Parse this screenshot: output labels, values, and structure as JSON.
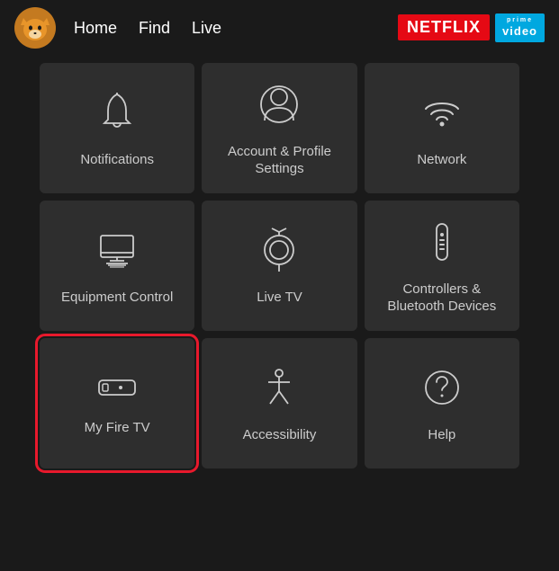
{
  "nav": {
    "links": [
      {
        "label": "Home",
        "active": false
      },
      {
        "label": "Find",
        "active": false
      },
      {
        "label": "Live",
        "active": false
      }
    ],
    "netflix_label": "NETFLIX",
    "prime_top": "prime",
    "prime_bottom": "video"
  },
  "grid": {
    "items": [
      {
        "id": "notifications",
        "label": "Notifications",
        "icon": "bell"
      },
      {
        "id": "account-profile",
        "label": "Account & Profile Settings",
        "icon": "person"
      },
      {
        "id": "network",
        "label": "Network",
        "icon": "wifi"
      },
      {
        "id": "equipment-control",
        "label": "Equipment Control",
        "icon": "monitor"
      },
      {
        "id": "live-tv",
        "label": "Live TV",
        "icon": "antenna"
      },
      {
        "id": "controllers-bluetooth",
        "label": "Controllers & Bluetooth Devices",
        "icon": "remote"
      },
      {
        "id": "my-fire-tv",
        "label": "My Fire TV",
        "icon": "firestick",
        "highlighted": true
      },
      {
        "id": "accessibility",
        "label": "Accessibility",
        "icon": "person-accessibility"
      },
      {
        "id": "help",
        "label": "Help",
        "icon": "question"
      }
    ]
  }
}
